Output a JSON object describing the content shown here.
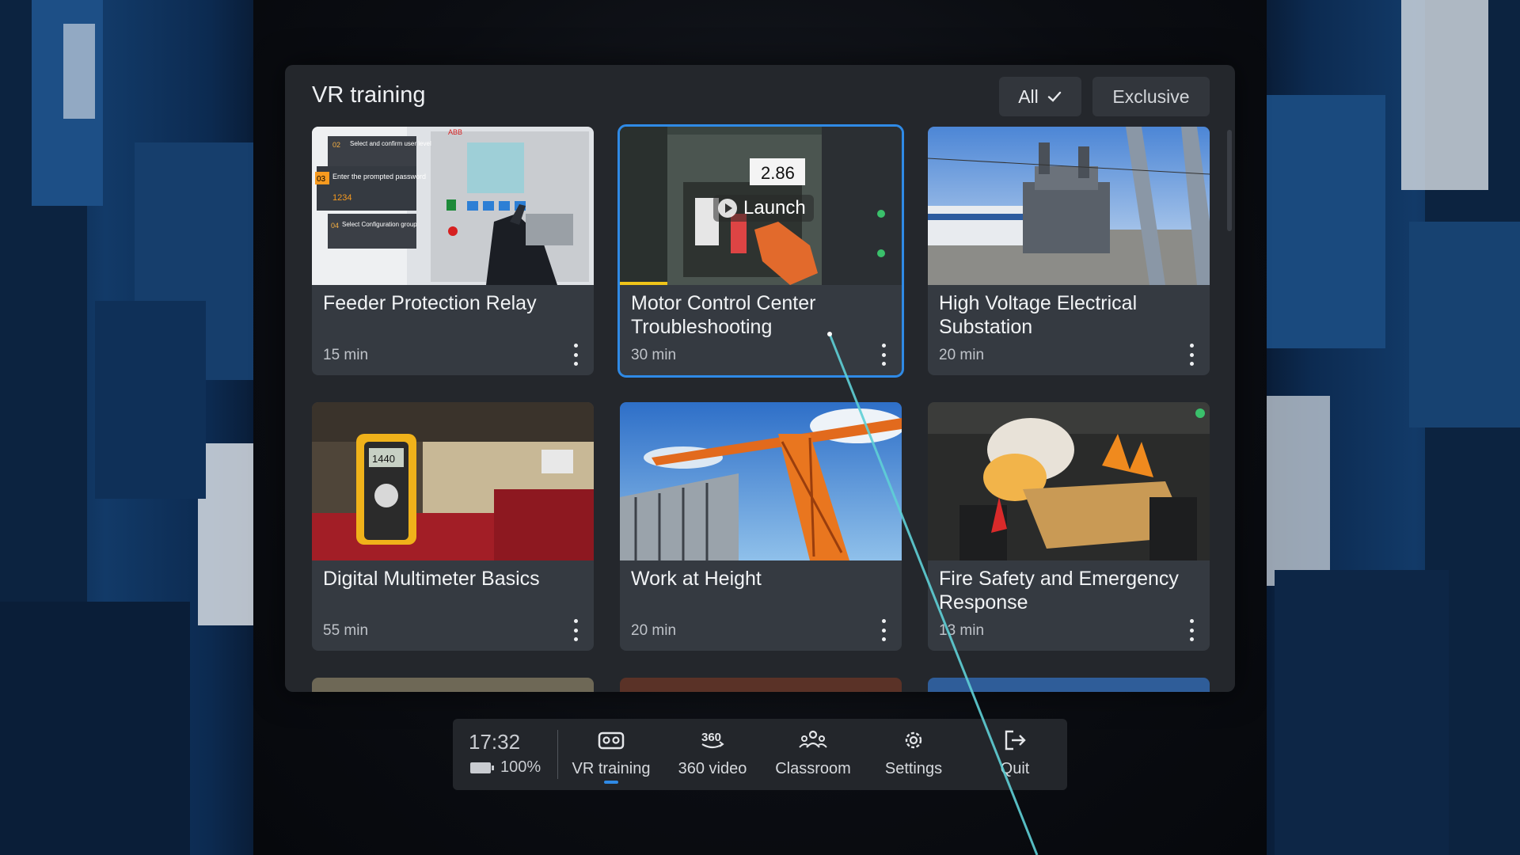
{
  "panel": {
    "title": "VR training",
    "filters": [
      {
        "label": "All",
        "active": true
      },
      {
        "label": "Exclusive",
        "active": false
      }
    ]
  },
  "courses": [
    {
      "title": "Feeder Protection Relay",
      "duration": "15 min"
    },
    {
      "title": "Motor Control Center Troubleshooting",
      "duration": "30 min",
      "selected": true,
      "hover_action": "Launch",
      "thumb_readout": "2.86"
    },
    {
      "title": "High Voltage Electrical Substation",
      "duration": "20 min"
    },
    {
      "title": "Digital Multimeter Basics",
      "duration": "55 min",
      "thumb_readout": "1440"
    },
    {
      "title": "Work at Height",
      "duration": "20 min"
    },
    {
      "title": "Fire Safety and Emergency Response",
      "duration": "13 min"
    }
  ],
  "thumb_texts": {
    "relay": [
      "02",
      "Select and confirm user level",
      "03",
      "Enter the prompted password",
      "1234",
      "04",
      "Select Configuration group",
      "ABB"
    ]
  },
  "dock": {
    "time": "17:32",
    "battery": "100%",
    "items": [
      {
        "label": "VR training",
        "icon": "vr-headset-icon",
        "active": true
      },
      {
        "label": "360 video",
        "icon": "360-video-icon"
      },
      {
        "label": "Classroom",
        "icon": "classroom-icon"
      },
      {
        "label": "Settings",
        "icon": "gear-icon"
      },
      {
        "label": "Quit",
        "icon": "exit-icon"
      }
    ]
  },
  "colors": {
    "accent": "#2f8ae6",
    "panel": "#24272c",
    "card": "#353a41"
  }
}
